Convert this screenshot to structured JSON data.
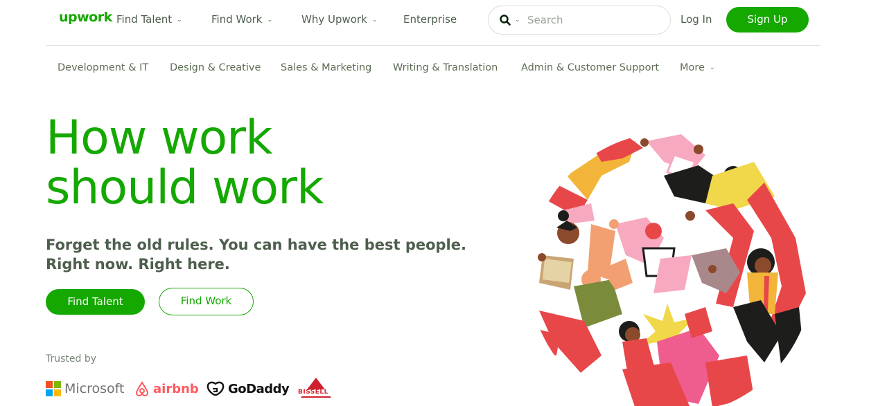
{
  "header": {
    "logo": "upwork",
    "nav": [
      {
        "label": "Find Talent",
        "has_dropdown": true
      },
      {
        "label": "Find Work",
        "has_dropdown": true
      },
      {
        "label": "Why Upwork",
        "has_dropdown": true
      },
      {
        "label": "Enterprise",
        "has_dropdown": false
      }
    ],
    "search": {
      "placeholder": "Search",
      "icon": "search-icon"
    },
    "login": "Log In",
    "signup": "Sign Up"
  },
  "categories": [
    "Development & IT",
    "Design & Creative",
    "Sales & Marketing",
    "Writing & Translation",
    "Admin & Customer Support",
    "More"
  ],
  "hero": {
    "title_line1": "How work",
    "title_line2": "should work",
    "subtitle_line1": "Forget the old rules. You can have the best people.",
    "subtitle_line2": "Right now. Right here.",
    "primary_button": "Find Talent",
    "secondary_button": "Find Work"
  },
  "trusted": {
    "label": "Trusted by",
    "brands": [
      "Microsoft",
      "airbnb",
      "GoDaddy",
      "BISSELL"
    ]
  },
  "colors": {
    "brand_green": "#14a800",
    "text_gray": "#4d5e4d",
    "border": "#d5e0d5"
  }
}
